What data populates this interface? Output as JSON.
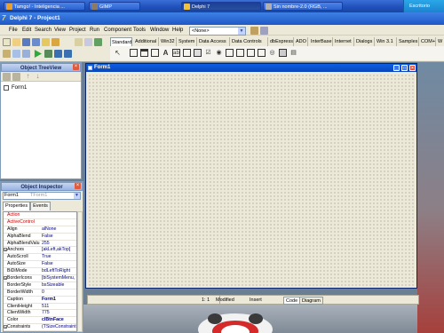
{
  "taskbar": {
    "tasks": [
      {
        "label": "Tamgo! - Inteligencia ...",
        "active": false
      },
      {
        "label": "GIMP",
        "active": false
      },
      {
        "label": "Delphi 7",
        "active": true
      },
      {
        "label": "Sin nombre-2.0 (RGB, ...",
        "active": false
      }
    ],
    "tray_label": "Escritorio"
  },
  "main_window": {
    "title": "Delphi 7 - Project1",
    "menus": [
      "File",
      "Edit",
      "Search",
      "View",
      "Project",
      "Run",
      "Component",
      "Tools",
      "Window",
      "Help"
    ],
    "config_combo": "<None>"
  },
  "palette": {
    "tabs": [
      "Standard",
      "Additional",
      "Win32",
      "System",
      "Data Access",
      "Data Controls",
      "dbExpress",
      "ADO",
      "InterBase",
      "Internet",
      "Dialogs",
      "Win 3.1",
      "Samples",
      "COM+",
      "W"
    ],
    "icons": [
      "pointer",
      "frame",
      "main-menu",
      "popup-menu",
      "label",
      "edit",
      "memo",
      "button",
      "checkbox",
      "radio",
      "listbox",
      "combobox",
      "scrollbar",
      "groupbox",
      "radiogroup",
      "panel",
      "actionlist"
    ]
  },
  "treeview": {
    "title": "Object TreeView",
    "node": "Form1"
  },
  "inspector": {
    "title": "Object Inspector",
    "selected_object": "Form1",
    "selected_type": "TForm1",
    "tabs": [
      "Properties",
      "Events"
    ],
    "properties": [
      {
        "name": "Action",
        "value": "",
        "event": true,
        "expand": false
      },
      {
        "name": "ActiveControl",
        "value": "",
        "event": true,
        "expand": false
      },
      {
        "name": "Align",
        "value": "alNone",
        "event": false,
        "expand": false
      },
      {
        "name": "AlphaBlend",
        "value": "False",
        "event": false,
        "expand": false
      },
      {
        "name": "AlphaBlendValu",
        "value": "255",
        "event": false,
        "expand": false
      },
      {
        "name": "Anchors",
        "value": "[akLeft,akTop]",
        "event": false,
        "expand": true
      },
      {
        "name": "AutoScroll",
        "value": "True",
        "event": false,
        "expand": false
      },
      {
        "name": "AutoSize",
        "value": "False",
        "event": false,
        "expand": false
      },
      {
        "name": "BiDiMode",
        "value": "bdLeftToRight",
        "event": false,
        "expand": false
      },
      {
        "name": "BorderIcons",
        "value": "[biSystemMenu,",
        "event": false,
        "expand": true
      },
      {
        "name": "BorderStyle",
        "value": "bsSizeable",
        "event": false,
        "expand": false
      },
      {
        "name": "BorderWidth",
        "value": "0",
        "event": false,
        "expand": false
      },
      {
        "name": "Caption",
        "value": "Form1",
        "event": false,
        "expand": false
      },
      {
        "name": "ClientHeight",
        "value": "511",
        "event": false,
        "expand": false
      },
      {
        "name": "ClientWidth",
        "value": "775",
        "event": false,
        "expand": false
      },
      {
        "name": "Color",
        "value": "clBtnFace",
        "event": false,
        "expand": false
      },
      {
        "name": "Constraints",
        "value": "(TSizeConstraint",
        "event": false,
        "expand": true
      }
    ]
  },
  "form": {
    "title": "Form1"
  },
  "editor_status": {
    "position": "1: 1",
    "modified": "Modified",
    "insert_mode": "Insert",
    "tabs": [
      "Code",
      "Diagram"
    ]
  }
}
